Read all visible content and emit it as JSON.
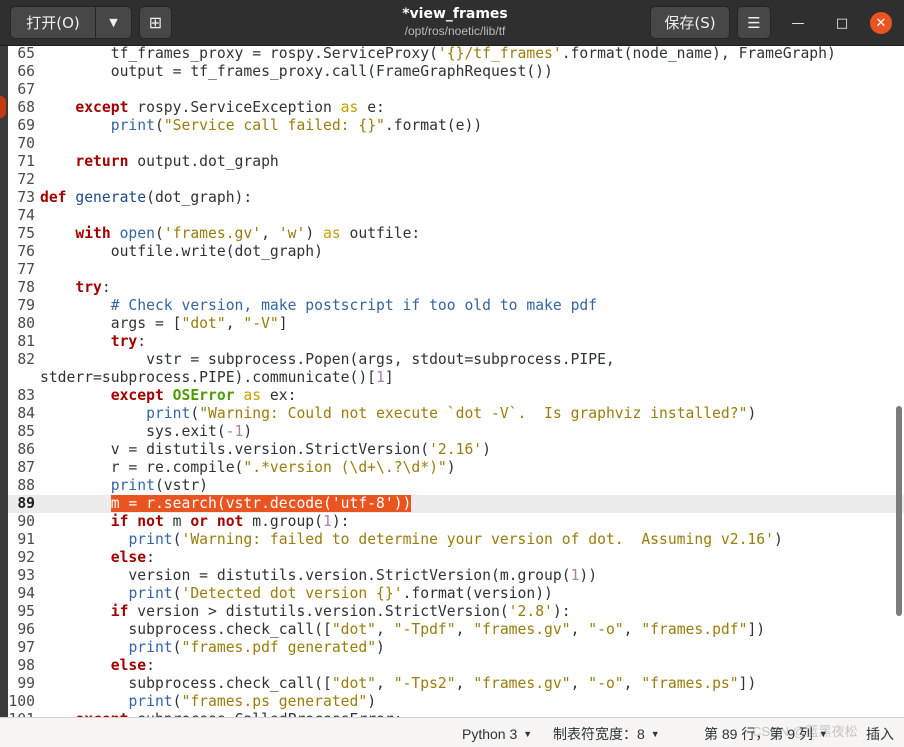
{
  "header": {
    "open_label": "打开(O)",
    "open_menu_icon": "▼",
    "new_tab_icon": "⊞",
    "title": "*view_frames",
    "subtitle": "/opt/ros/noetic/lib/tf",
    "save_label": "保存(S)",
    "menu_icon": "☰",
    "minimize_icon": "—",
    "maximize_icon": "□",
    "close_icon": "✕"
  },
  "editor": {
    "current_line": "89",
    "lines": [
      {
        "n": "65",
        "html": "        tf_frames_proxy = rospy.ServiceProxy(<span class=\"st2\">'{}/tf_frames'</span>.format(node_name), FrameGraph)"
      },
      {
        "n": "66",
        "html": "        output = tf_frames_proxy.call(FrameGraphRequest())"
      },
      {
        "n": "67",
        "html": ""
      },
      {
        "n": "68",
        "html": "    <span class=\"kw\">except</span> rospy.ServiceException <span class=\"st\">as</span> e:"
      },
      {
        "n": "69",
        "html": "        <span class=\"bi\">print</span>(<span class=\"st2\">\"Service call failed: {}\"</span>.format(e))"
      },
      {
        "n": "70",
        "html": ""
      },
      {
        "n": "71",
        "html": "    <span class=\"kw\">return</span> output.dot_graph"
      },
      {
        "n": "72",
        "html": ""
      },
      {
        "n": "73",
        "html": "<span class=\"kw\">def</span> <span class=\"fn\">generate</span>(dot_graph):"
      },
      {
        "n": "74",
        "html": ""
      },
      {
        "n": "75",
        "html": "    <span class=\"kw\">with</span> <span class=\"bi\">open</span>(<span class=\"st2\">'frames.gv'</span>, <span class=\"st2\">'w'</span>) <span class=\"st\">as</span> outfile:"
      },
      {
        "n": "76",
        "html": "        outfile.write(dot_graph)"
      },
      {
        "n": "77",
        "html": ""
      },
      {
        "n": "78",
        "html": "    <span class=\"kw\">try</span>:"
      },
      {
        "n": "79",
        "html": "        <span class=\"cm\"># Check version, make postscript if too old to make pdf</span>"
      },
      {
        "n": "80",
        "html": "        args = [<span class=\"st2\">\"dot\"</span>, <span class=\"st2\">\"-V\"</span>]"
      },
      {
        "n": "81",
        "html": "        <span class=\"kw\">try</span>:"
      },
      {
        "n": "82",
        "html": "            vstr = subprocess.Popen(args, stdout=subprocess.PIPE,"
      },
      {
        "n": "",
        "html": "stderr=subprocess.PIPE).communicate()[<span class=\"num\">1</span>]",
        "wrap": true
      },
      {
        "n": "83",
        "html": "        <span class=\"kw\">except</span> <span class=\"ex\">OSError</span> <span class=\"st\">as</span> ex:"
      },
      {
        "n": "84",
        "html": "            <span class=\"bi\">print</span>(<span class=\"st2\">\"Warning: Could not execute `dot -V`.  Is graphviz installed?\"</span>)"
      },
      {
        "n": "85",
        "html": "            sys.exit(<span class=\"num\">-1</span>)"
      },
      {
        "n": "86",
        "html": "        v = distutils.version.StrictVersion(<span class=\"st2\">'2.16'</span>)"
      },
      {
        "n": "87",
        "html": "        r = re.compile(<span class=\"st2\">\".*version (\\d+\\.?\\d*)\"</span>)"
      },
      {
        "n": "88",
        "html": "        <span class=\"bi\">print</span>(vstr)"
      },
      {
        "n": "89",
        "html": "        <span class=\"sel\">m = r.search(vstr.decode('utf-8'))</span>",
        "current": true
      },
      {
        "n": "90",
        "html": "        <span class=\"kw\">if</span> <span class=\"kw\">not</span> m <span class=\"kw\">or</span> <span class=\"kw\">not</span> m.group(<span class=\"num\">1</span>):"
      },
      {
        "n": "91",
        "html": "          <span class=\"bi\">print</span>(<span class=\"st2\">'Warning: failed to determine your version of dot.  Assuming v2.16'</span>)"
      },
      {
        "n": "92",
        "html": "        <span class=\"kw\">else</span>:"
      },
      {
        "n": "93",
        "html": "          version = distutils.version.StrictVersion(m.group(<span class=\"num\">1</span>))"
      },
      {
        "n": "94",
        "html": "          <span class=\"bi\">print</span>(<span class=\"st2\">'Detected dot version {}'</span>.format(version))"
      },
      {
        "n": "95",
        "html": "        <span class=\"kw\">if</span> version &gt; distutils.version.StrictVersion(<span class=\"st2\">'2.8'</span>):"
      },
      {
        "n": "96",
        "html": "          subprocess.check_call([<span class=\"st2\">\"dot\"</span>, <span class=\"st2\">\"-Tpdf\"</span>, <span class=\"st2\">\"frames.gv\"</span>, <span class=\"st2\">\"-o\"</span>, <span class=\"st2\">\"frames.pdf\"</span>])"
      },
      {
        "n": "97",
        "html": "          <span class=\"bi\">print</span>(<span class=\"st2\">\"frames.pdf generated\"</span>)"
      },
      {
        "n": "98",
        "html": "        <span class=\"kw\">else</span>:"
      },
      {
        "n": "99",
        "html": "          subprocess.check_call([<span class=\"st2\">\"dot\"</span>, <span class=\"st2\">\"-Tps2\"</span>, <span class=\"st2\">\"frames.gv\"</span>, <span class=\"st2\">\"-o\"</span>, <span class=\"st2\">\"frames.ps\"</span>])"
      },
      {
        "n": "100",
        "html": "          <span class=\"bi\">print</span>(<span class=\"st2\">\"frames.ps generated\"</span>)"
      },
      {
        "n": "101",
        "html": "    <span class=\"kw\">except</span> subprocess.CalledProcessError:"
      }
    ]
  },
  "statusbar": {
    "language": "Python 3",
    "tab_width": "制表符宽度：8",
    "position": "第 89 行，第 9 列",
    "insert_mode": "插入",
    "watermark": "CSDN @蓝黑夜松",
    "caret_icon": "▼"
  },
  "colors": {
    "accent": "#e95420",
    "headerbar": "#2f2f2f",
    "editor_bg": "#ffffff",
    "current_line_bg": "#ececec"
  }
}
